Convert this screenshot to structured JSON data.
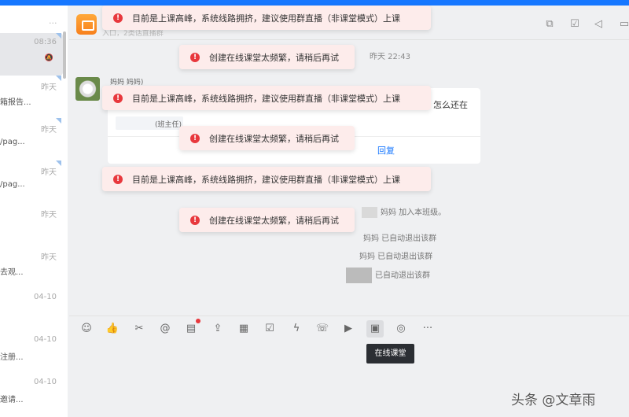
{
  "sidebar": {
    "items": [
      {
        "time": "08:36",
        "snippet": ""
      },
      {
        "time": "昨天",
        "snippet": "箱报告..."
      },
      {
        "time": "昨天",
        "snippet": "/pag..."
      },
      {
        "time": "昨天",
        "snippet": "/pag..."
      },
      {
        "time": "昨天",
        "snippet": ""
      },
      {
        "time": "昨天",
        "snippet": "去观..."
      },
      {
        "time": "04-10",
        "snippet": ""
      },
      {
        "time": "04-10",
        "snippet": "注册..."
      },
      {
        "time": "04-10",
        "snippet": "邀请..."
      }
    ],
    "more": "···"
  },
  "header": {
    "subtitle": "入口，2类话直播群"
  },
  "toasts": {
    "peak": "目前是上课高峰，系统线路拥挤，建议使用群直播（非课堂模式）上课",
    "frequent": "创建在线课堂太频繁，请稍后再试"
  },
  "chat": {
    "time": "昨天 22:43",
    "sender_names": "妈妈    妈妈)",
    "message_tail": "？怎么还在",
    "tag": "(班主任)",
    "reply": "回复",
    "system": [
      "妈妈 加入本班级。",
      "妈妈 已自动退出该群",
      "妈妈 已自动退出该群",
      "已自动退出该群"
    ]
  },
  "toolbar": {
    "tooltip": "在线课堂"
  },
  "watermark": "头条 @文章雨"
}
